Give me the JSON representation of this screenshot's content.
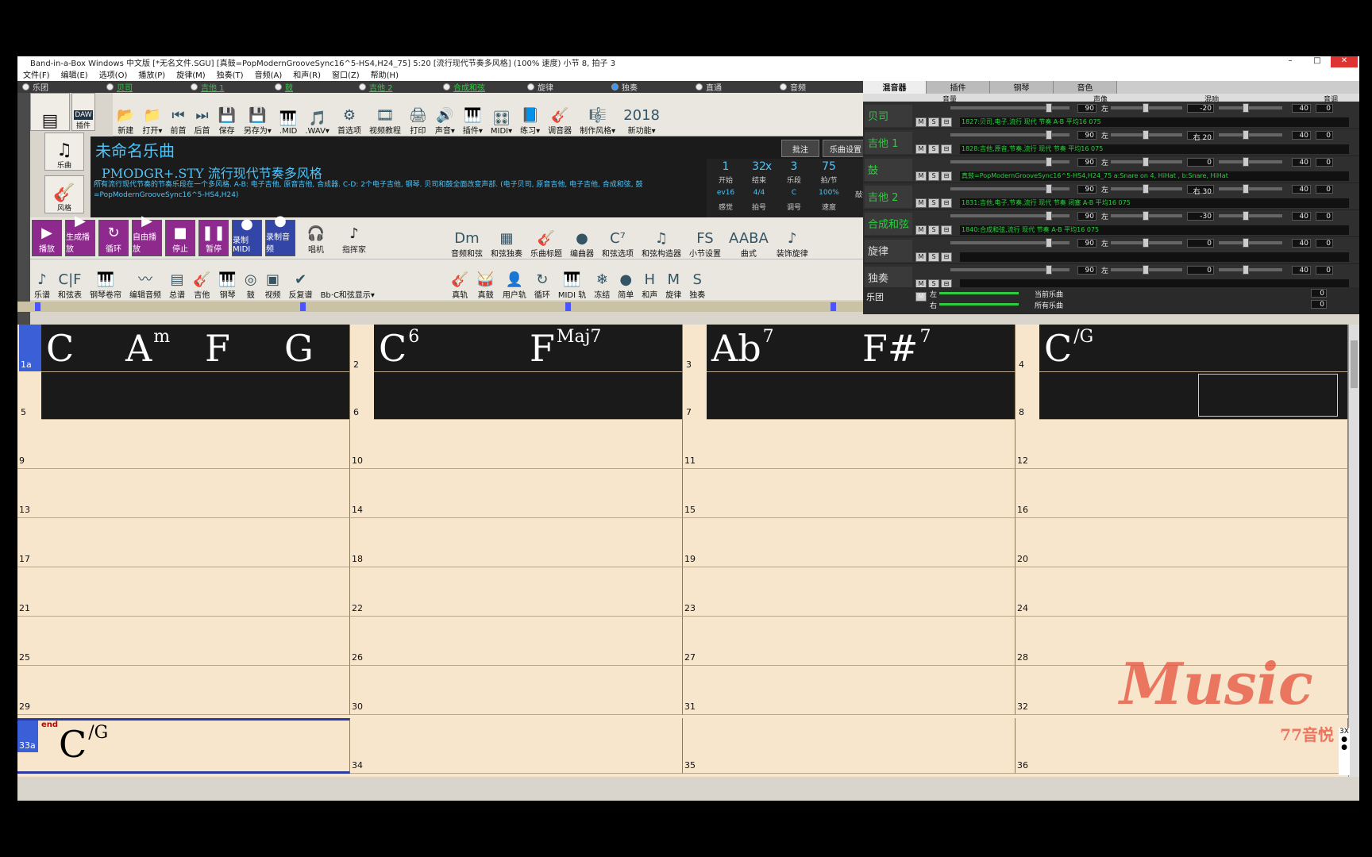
{
  "window": {
    "title": "Band-in-a-Box Windows 中文版  [*无名文件.SGU] [真鼓=PopModernGrooveSync16^5-HS4,H24_75]    5:20  [流行现代节奏多风格] (100% 速度) 小节 8, 拍子 3",
    "min": "–",
    "max": "□",
    "close": "✕"
  },
  "menu": [
    "文件(F)",
    "编辑(E)",
    "选项(O)",
    "播放(P)",
    "旋律(M)",
    "独奏(T)",
    "音频(A)",
    "和声(R)",
    "窗口(Z)",
    "帮助(H)"
  ],
  "tracks": [
    {
      "label": "乐团",
      "green": false,
      "on": false
    },
    {
      "label": "贝司",
      "green": true,
      "on": false
    },
    {
      "label": "吉他 1",
      "green": true,
      "on": false
    },
    {
      "label": "鼓",
      "green": true,
      "on": false
    },
    {
      "label": "吉他 2",
      "green": true,
      "on": false
    },
    {
      "label": "合成和弦",
      "green": true,
      "on": false
    },
    {
      "label": "旋律",
      "green": false,
      "on": false
    },
    {
      "label": "独奏",
      "green": false,
      "on": true
    },
    {
      "label": "直通",
      "green": false,
      "on": false
    },
    {
      "label": "音频",
      "green": false,
      "on": false
    }
  ],
  "side": {
    "daw": "插件",
    "song": "乐曲",
    "style": "风格"
  },
  "toolbar1": [
    {
      "label": "新建",
      "icon": "📂"
    },
    {
      "label": "打开▾",
      "icon": "📁"
    },
    {
      "label": "前首",
      "icon": "⏮"
    },
    {
      "label": "后首",
      "icon": "⏭"
    },
    {
      "label": "保存",
      "icon": "💾"
    },
    {
      "label": "另存为▾",
      "icon": "💾"
    },
    {
      "label": ".MID",
      "icon": "🎹"
    },
    {
      "label": ".WAV▾",
      "icon": "🎵"
    },
    {
      "label": "首选项",
      "icon": "⚙"
    },
    {
      "label": "视频教程",
      "icon": "🎞"
    },
    {
      "label": "打印",
      "icon": "🖨"
    },
    {
      "label": "声音▾",
      "icon": "🔊"
    },
    {
      "label": "插件▾",
      "icon": "🎹"
    },
    {
      "label": "MIDI▾",
      "icon": "🎛"
    },
    {
      "label": "练习▾",
      "icon": "📘"
    },
    {
      "label": "调音器",
      "icon": "🎸"
    },
    {
      "label": "制作风格▾",
      "icon": "🎼"
    },
    {
      "label": "新功能▾",
      "icon": "2018"
    }
  ],
  "song": {
    "title": "未命名乐曲",
    "memo": "批注",
    "settings": "乐曲设置",
    "style_name": "_PMODGR+.STY 流行现代节奏多风格",
    "style_desc": "所有流行现代节奏的节奏乐段在一个多风格. A-B: 电子吉他, 原音吉他, 合成器. C-D: 2个电子吉他, 钢琴. 贝司和鼓全面改变声部.    (电子贝司, 原音吉他, 电子吉他, 合成和弦, 鼓=PopModernGrooveSync16^5-HS4,H24)",
    "start": "1",
    "end": "32",
    "x": "x",
    "choruses": "3",
    "tempo": "75",
    "start_lbl": "开始",
    "end_lbl": "结束",
    "chorus_lbl": "乐段",
    "tempo_lbl": "拍/节",
    "feel": "ev16",
    "timesig": "4/4",
    "key": "C",
    "speed": "100%",
    "feel_lbl": "感觉",
    "timesig_lbl": "拍号",
    "key_lbl": "调号",
    "speed_lbl": "速度",
    "tap": "敲打"
  },
  "transport": [
    {
      "label": "播放",
      "icon": "▶",
      "bg": "#8e2a8e"
    },
    {
      "label": "生成播放",
      "icon": "▶",
      "bg": "#8e2a8e"
    },
    {
      "label": "循环",
      "icon": "↻",
      "bg": "#8e2a8e"
    },
    {
      "label": "自由播放",
      "icon": "▶",
      "bg": "#8e2a8e"
    },
    {
      "label": "停止",
      "icon": "■",
      "bg": "#8e2a8e"
    },
    {
      "label": "暂停",
      "icon": "❚❚",
      "bg": "#8e2a8e"
    },
    {
      "label": "录制MIDI",
      "icon": "●",
      "bg": "#3346a8"
    },
    {
      "label": "录制音频",
      "icon": "●",
      "bg": "#3346a8"
    },
    {
      "label": "唱机",
      "icon": "🎧",
      "bg": "none"
    },
    {
      "label": "指挥家",
      "icon": "♪",
      "bg": "none"
    }
  ],
  "toolbar2": [
    {
      "label": "音频和弦",
      "icon": "Dm"
    },
    {
      "label": "和弦独奏",
      "icon": "▦"
    },
    {
      "label": "乐曲标题",
      "icon": "🎸"
    },
    {
      "label": "编曲器",
      "icon": "●"
    },
    {
      "label": "和弦选项",
      "icon": "C⁷"
    },
    {
      "label": "和弦构造器",
      "icon": "♫"
    },
    {
      "label": "小节设置",
      "icon": "FS"
    },
    {
      "label": "曲式",
      "icon": "AABA"
    },
    {
      "label": "装饰旋律",
      "icon": "♪"
    }
  ],
  "toolbar3": [
    {
      "label": "乐谱",
      "icon": "♪"
    },
    {
      "label": "和弦表",
      "icon": "C|F"
    },
    {
      "label": "钢琴卷帘",
      "icon": "🎹"
    },
    {
      "label": "编辑音频",
      "icon": "〰"
    },
    {
      "label": "总谱",
      "icon": "▤"
    },
    {
      "label": "吉他",
      "icon": "🎸"
    },
    {
      "label": "钢琴",
      "icon": "🎹"
    },
    {
      "label": "鼓",
      "icon": "◎"
    },
    {
      "label": "视频",
      "icon": "▣"
    },
    {
      "label": "反复谱",
      "icon": "✔"
    },
    {
      "label": "Bb·C和弦显示▾",
      "icon": ""
    }
  ],
  "toolbar4": [
    {
      "label": "真轨",
      "icon": "🎸"
    },
    {
      "label": "真鼓",
      "icon": "🥁"
    },
    {
      "label": "用户轨",
      "icon": "👤"
    },
    {
      "label": "循环",
      "icon": "↻"
    },
    {
      "label": "MIDI 轨",
      "icon": "🎹"
    },
    {
      "label": "冻结",
      "icon": "❄"
    },
    {
      "label": "简单",
      "icon": "●"
    },
    {
      "label": "和声",
      "icon": "H"
    },
    {
      "label": "旋律",
      "icon": "M"
    },
    {
      "label": "独奏",
      "icon": "S"
    }
  ],
  "mixer": {
    "tabs": [
      "混音器",
      "插件",
      "钢琴",
      "音色"
    ],
    "header": [
      "音量",
      "声像",
      "混响",
      "音调"
    ],
    "rows": [
      {
        "name": "贝司",
        "green": true,
        "vol": "90",
        "pan_l": "左",
        "pan": "-20",
        "rev": "40",
        "tone": "0",
        "info": "1827:贝司,电子,流行 现代 节奏 A-B 平均16 075"
      },
      {
        "name": "吉他 1",
        "green": true,
        "vol": "90",
        "pan_l": "左",
        "pan": "右 20",
        "rev": "40",
        "tone": "0",
        "info": "1828:吉他,原音,节奏,流行 现代 节奏 平均16 075"
      },
      {
        "name": "鼓",
        "green": true,
        "vol": "90",
        "pan_l": "左",
        "pan": "0",
        "rev": "40",
        "tone": "0",
        "info": "真鼓=PopModernGrooveSync16^5-HS4,H24_75 a:Snare on 4, HiHat , b:Snare, HiHat"
      },
      {
        "name": "吉他 2",
        "green": true,
        "vol": "90",
        "pan_l": "左",
        "pan": "右 30",
        "rev": "40",
        "tone": "0",
        "info": "1831:吉他,电子,节奏,流行 现代 节奏 闭塞 A-B 平均16 075"
      },
      {
        "name": "合成和弦",
        "green": true,
        "vol": "90",
        "pan_l": "左",
        "pan": "-30",
        "rev": "40",
        "tone": "0",
        "info": "1840:合成和弦,流行 现代 节奏 A-B 平均16 075"
      },
      {
        "name": "旋律",
        "green": false,
        "vol": "90",
        "pan_l": "左",
        "pan": "0",
        "rev": "40",
        "tone": "0",
        "info": ""
      },
      {
        "name": "独奏",
        "green": false,
        "vol": "90",
        "pan_l": "左",
        "pan": "0",
        "rev": "40",
        "tone": "0",
        "info": ""
      }
    ],
    "band": {
      "name": "乐团",
      "left": "左",
      "right": "右",
      "cur": "当前乐曲",
      "all": "所有乐曲",
      "cur_val": "0",
      "all_val": "0"
    }
  },
  "bars": [
    {
      "n": "1a",
      "chords": [
        {
          "r": "C",
          "s": ""
        },
        {
          "r": "A",
          "s": "m"
        },
        {
          "r": "F",
          "s": ""
        },
        {
          "r": "G",
          "s": ""
        }
      ]
    },
    {
      "n": "2",
      "chords": [
        {
          "r": "C",
          "s": "6"
        },
        {
          "r": "F",
          "s": "Maj7"
        }
      ]
    },
    {
      "n": "3",
      "chords": [
        {
          "r": "Ab",
          "s": "7"
        },
        {
          "r": "F#",
          "s": "7"
        }
      ]
    },
    {
      "n": "4",
      "chords": [
        {
          "r": "C",
          "s": "/G"
        }
      ]
    },
    {
      "n": "5",
      "chords": []
    },
    {
      "n": "6",
      "chords": []
    },
    {
      "n": "7",
      "chords": []
    },
    {
      "n": "8",
      "chords": []
    },
    {
      "n": "9"
    },
    {
      "n": "10"
    },
    {
      "n": "11"
    },
    {
      "n": "12"
    },
    {
      "n": "13"
    },
    {
      "n": "14"
    },
    {
      "n": "15"
    },
    {
      "n": "16"
    },
    {
      "n": "17"
    },
    {
      "n": "18"
    },
    {
      "n": "19"
    },
    {
      "n": "20"
    },
    {
      "n": "21"
    },
    {
      "n": "22"
    },
    {
      "n": "23"
    },
    {
      "n": "24"
    },
    {
      "n": "25"
    },
    {
      "n": "26"
    },
    {
      "n": "27"
    },
    {
      "n": "28"
    },
    {
      "n": "29"
    },
    {
      "n": "30"
    },
    {
      "n": "31"
    },
    {
      "n": "32"
    },
    {
      "n": "33a",
      "end": "end",
      "chords": [
        {
          "r": "C",
          "s": "/G"
        }
      ]
    },
    {
      "n": "34"
    },
    {
      "n": "35"
    },
    {
      "n": "36"
    }
  ],
  "repeat": "3X",
  "watermark": {
    "text": "Music",
    "sub": "77音悦"
  }
}
